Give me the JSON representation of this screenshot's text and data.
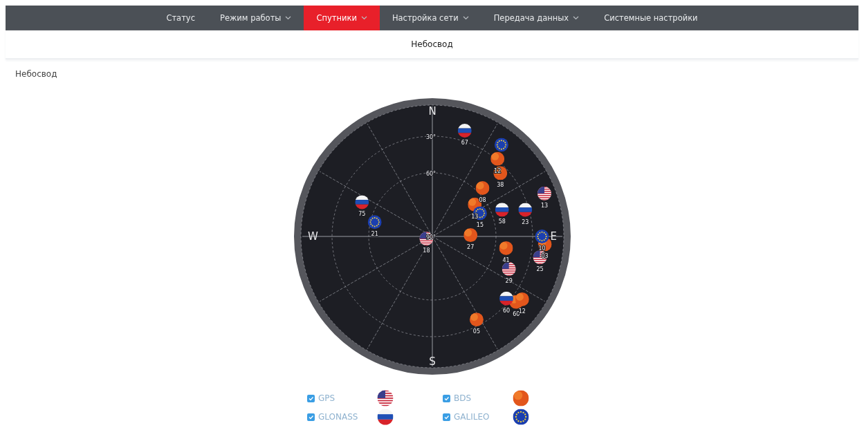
{
  "nav": {
    "items": [
      {
        "label": "Статус",
        "dropdown": false,
        "selected": false
      },
      {
        "label": "Режим работы",
        "dropdown": true,
        "selected": false
      },
      {
        "label": "Спутники",
        "dropdown": true,
        "selected": true
      },
      {
        "label": "Настройка сети",
        "dropdown": true,
        "selected": false
      },
      {
        "label": "Передача данных",
        "dropdown": true,
        "selected": false
      },
      {
        "label": "Системные настройки",
        "dropdown": false,
        "selected": false
      }
    ]
  },
  "subnav": {
    "items": [
      {
        "label": "Небосвод",
        "selected": true
      }
    ]
  },
  "section": {
    "title": "Небосвод"
  },
  "skyplot": {
    "directions": [
      "N",
      "E",
      "S",
      "W"
    ],
    "rings": [
      "30°",
      "60°",
      "90°"
    ],
    "satellites": [
      {
        "kind": "gps",
        "label": "13"
      },
      {
        "kind": "gps",
        "label": "25"
      },
      {
        "kind": "gps",
        "label": "29"
      },
      {
        "kind": "gps",
        "label": "18"
      },
      {
        "kind": "bds",
        "label": "12"
      },
      {
        "kind": "bds",
        "label": "38"
      },
      {
        "kind": "bds",
        "label": "08"
      },
      {
        "kind": "bds",
        "label": "13"
      },
      {
        "kind": "bds",
        "label": "03"
      },
      {
        "kind": "bds",
        "label": "27"
      },
      {
        "kind": "bds",
        "label": "41"
      },
      {
        "kind": "bds",
        "label": "60"
      },
      {
        "kind": "bds",
        "label": "12"
      },
      {
        "kind": "bds",
        "label": "05"
      },
      {
        "kind": "glonass",
        "label": "67"
      },
      {
        "kind": "glonass",
        "label": "58"
      },
      {
        "kind": "glonass",
        "label": "23"
      },
      {
        "kind": "glonass",
        "label": "75"
      },
      {
        "kind": "glonass",
        "label": "60"
      },
      {
        "kind": "galileo"
      },
      {
        "kind": "galileo",
        "label": "15"
      },
      {
        "kind": "galileo",
        "label": "10"
      },
      {
        "kind": "galileo",
        "label": "21"
      }
    ]
  },
  "legend": [
    {
      "name": "GPS",
      "kind": "gps",
      "checked": true
    },
    {
      "name": "BDS",
      "kind": "bds",
      "checked": true
    },
    {
      "name": "GLONASS",
      "kind": "glonass",
      "checked": true
    },
    {
      "name": "GALILEO",
      "kind": "galileo",
      "checked": true
    }
  ]
}
